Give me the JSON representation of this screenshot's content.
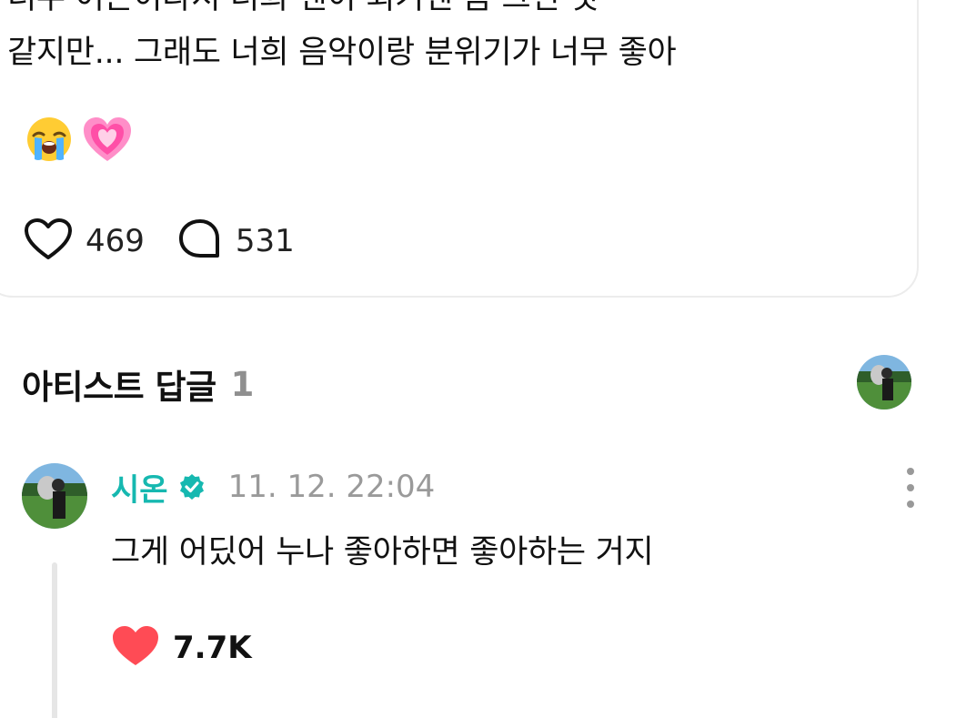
{
  "post": {
    "text_lines": [
      "너무 어른이라서 너희 팬이 되기엔 좀 그런 것",
      "같지만... 그래도 너희 음악이랑 분위기가 너무 좋아"
    ],
    "emojis": [
      "loudly-crying-face",
      "growing-heart"
    ],
    "likes": "469",
    "comments": "531"
  },
  "section": {
    "title": "아티스트 답글",
    "count": "1"
  },
  "reply": {
    "author": "시온",
    "timestamp": "11. 12. 22:04",
    "text": "그게 어딨어 누나 좋아하면 좋아하는 거지",
    "likes": "7.7K"
  },
  "colors": {
    "accent": "#16b8b0",
    "like_red": "#ff4b55",
    "muted": "#9a9a9a"
  }
}
